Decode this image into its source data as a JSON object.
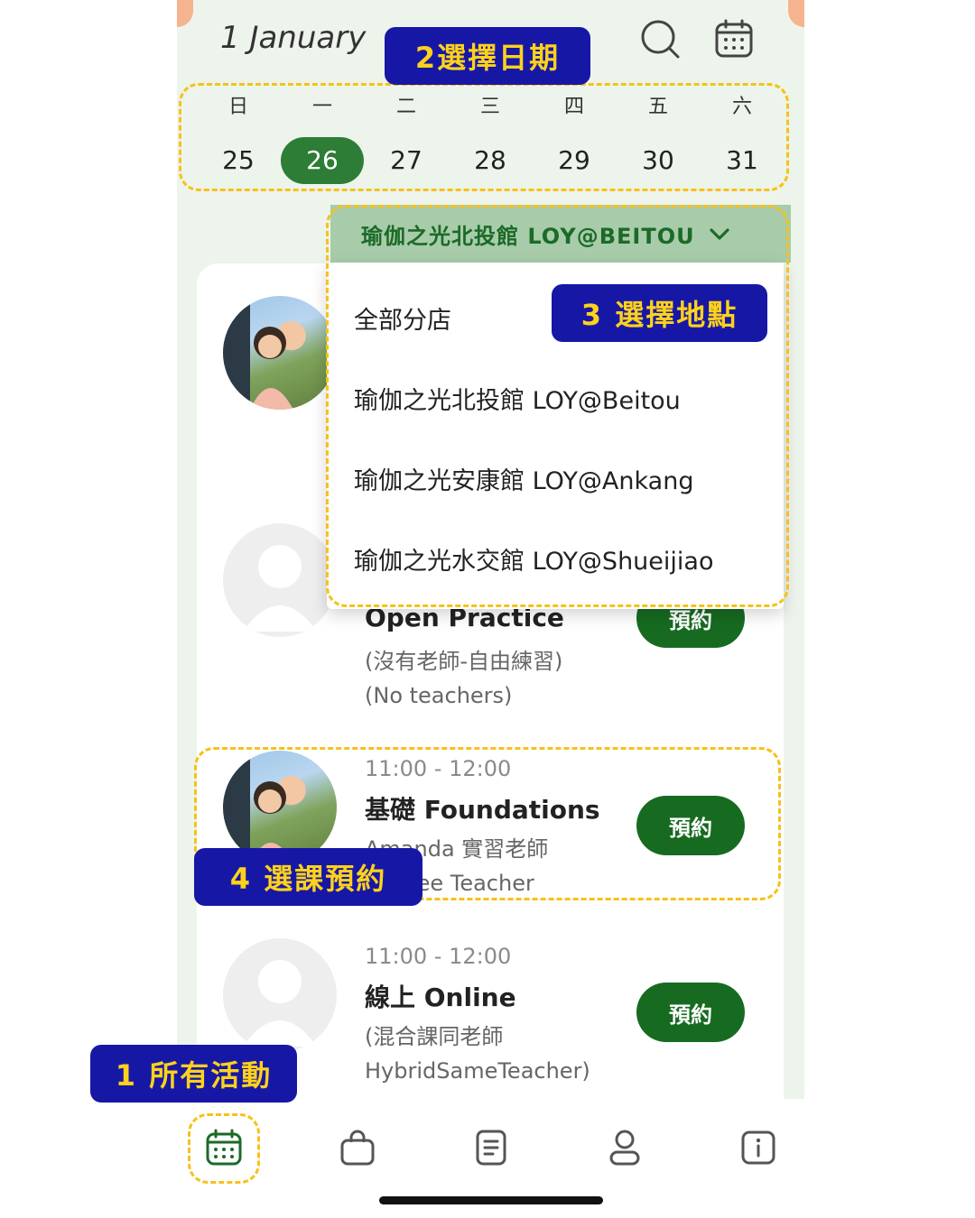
{
  "header": {
    "date_title": "1 January"
  },
  "week": [
    {
      "name": "日",
      "num": "25"
    },
    {
      "name": "一",
      "num": "26",
      "selected": true
    },
    {
      "name": "二",
      "num": "27"
    },
    {
      "name": "三",
      "num": "28"
    },
    {
      "name": "四",
      "num": "29"
    },
    {
      "name": "五",
      "num": "30"
    },
    {
      "name": "六",
      "num": "31"
    }
  ],
  "location": {
    "selected": "瑜伽之光北投館 LOY@BEITOU",
    "options": [
      "全部分店",
      "瑜伽之光北投館 LOY@Beitou",
      "瑜伽之光安康館 LOY@Ankang",
      "瑜伽之光水交館 LOY@Shueijiao"
    ]
  },
  "classes": [
    {
      "name": "Open Practice",
      "sub1": "(沒有老師-自由練習)",
      "sub2": "(No teachers)",
      "button": "預約"
    },
    {
      "time": "11:00 - 12:00",
      "name": "基礎 Foundations",
      "sub1": "Amanda 實習老師",
      "sub2": "Trainee Teacher",
      "button": "預約"
    },
    {
      "time": "11:00 - 12:00",
      "name": "線上 Online",
      "sub1": "(混合課同老師",
      "sub2": "HybridSameTeacher)",
      "button": "預約"
    }
  ],
  "annotations": {
    "step1": "1 所有活動",
    "step2": "2選擇日期",
    "step3": "3 選擇地點",
    "step4": "4  選課預約"
  },
  "colors": {
    "accent": "#2e7d37",
    "button": "#176b21",
    "badge_bg": "#1717a6",
    "badge_text": "#ffd21a",
    "dash": "#f6c21a"
  },
  "icons": {
    "top": [
      "search-icon",
      "calendar-icon"
    ],
    "tabs": [
      "calendar-icon",
      "shopping-bag-icon",
      "document-icon",
      "user-icon",
      "info-icon"
    ]
  }
}
